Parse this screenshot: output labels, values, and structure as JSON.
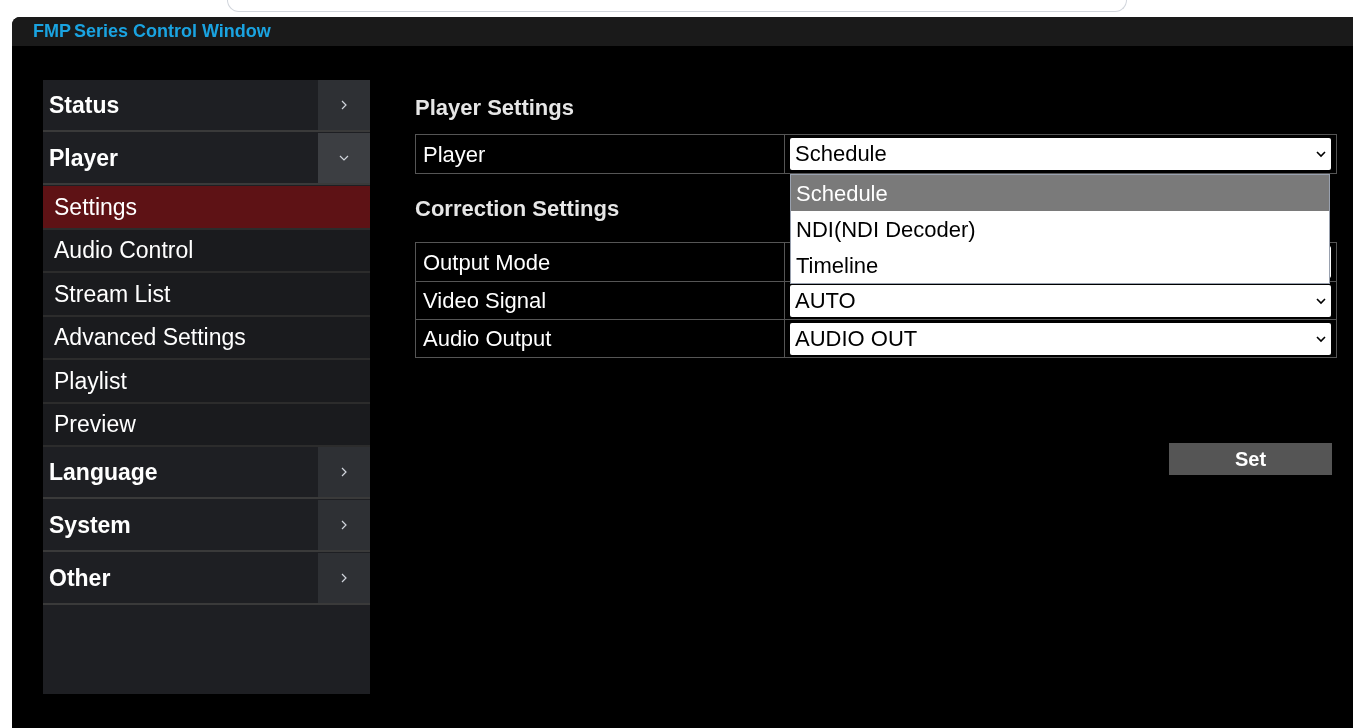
{
  "window": {
    "title_parts": [
      "FMP",
      "Series Control Window"
    ]
  },
  "sidebar": {
    "items": [
      {
        "label": "Status",
        "expanded": false
      },
      {
        "label": "Player",
        "expanded": true,
        "children": [
          {
            "label": "Settings",
            "selected": true
          },
          {
            "label": "Audio Control",
            "selected": false
          },
          {
            "label": "Stream List",
            "selected": false
          },
          {
            "label": "Advanced Settings",
            "selected": false
          },
          {
            "label": "Playlist",
            "selected": false
          },
          {
            "label": "Preview",
            "selected": false
          }
        ]
      },
      {
        "label": "Language",
        "expanded": false
      },
      {
        "label": "System",
        "expanded": false
      },
      {
        "label": "Other",
        "expanded": false
      }
    ]
  },
  "player_settings": {
    "title": "Player Settings",
    "rows": [
      {
        "label": "Player",
        "value": "Schedule",
        "open": true,
        "options": [
          {
            "label": "Schedule",
            "selected": true
          },
          {
            "label": "NDI(NDI Decoder)",
            "selected": false
          },
          {
            "label": "Timeline",
            "selected": false
          }
        ]
      }
    ]
  },
  "correction_settings": {
    "title": "Correction Settings",
    "rows": [
      {
        "label": "Output Mode"
      },
      {
        "label": "Video Signal",
        "value": "AUTO"
      },
      {
        "label": "Audio Output",
        "value": "AUDIO OUT"
      }
    ]
  },
  "set_button": "Set"
}
